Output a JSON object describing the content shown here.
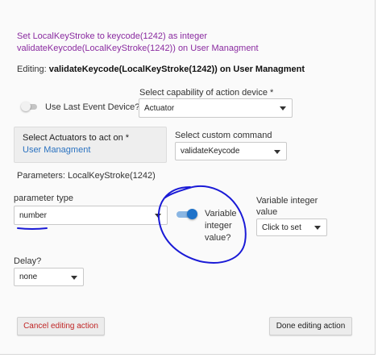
{
  "summary": {
    "line1": "Set LocalKeyStroke to keycode(1242) as integer",
    "line2": "validateKeycode(LocalKeyStroke(1242)) on User Managment"
  },
  "editing": {
    "prefix": "Editing: ",
    "value": "validateKeycode(LocalKeyStroke(1242)) on User Managment"
  },
  "use_last_event": {
    "label": "Use Last Event Device?",
    "enabled": false
  },
  "capability": {
    "label": "Select capability of action device *",
    "selected": "Actuator"
  },
  "actuators": {
    "label": "Select Actuators to act on *",
    "selected": "User Managment"
  },
  "custom_command": {
    "label": "Select custom command",
    "selected": "validateKeycode"
  },
  "parameters_label": "Parameters: LocalKeyStroke(1242)",
  "parameter_type": {
    "label": "parameter type",
    "selected": "number"
  },
  "variable_toggle": {
    "line1": "Variable",
    "line2": "integer",
    "line3": "value?",
    "enabled": true
  },
  "variable_integer": {
    "line1": "Variable integer",
    "line2": "value",
    "selected": "Click to set"
  },
  "delay": {
    "label": "Delay?",
    "selected": "none"
  },
  "buttons": {
    "cancel": "Cancel editing action",
    "done": "Done editing action"
  },
  "colors": {
    "summary_text": "#8a2ba0",
    "link_text": "#2a72c0",
    "cancel_text": "#c02525",
    "toggle_on": "#1e72c9",
    "annotation_ink": "#1a1ad6"
  }
}
